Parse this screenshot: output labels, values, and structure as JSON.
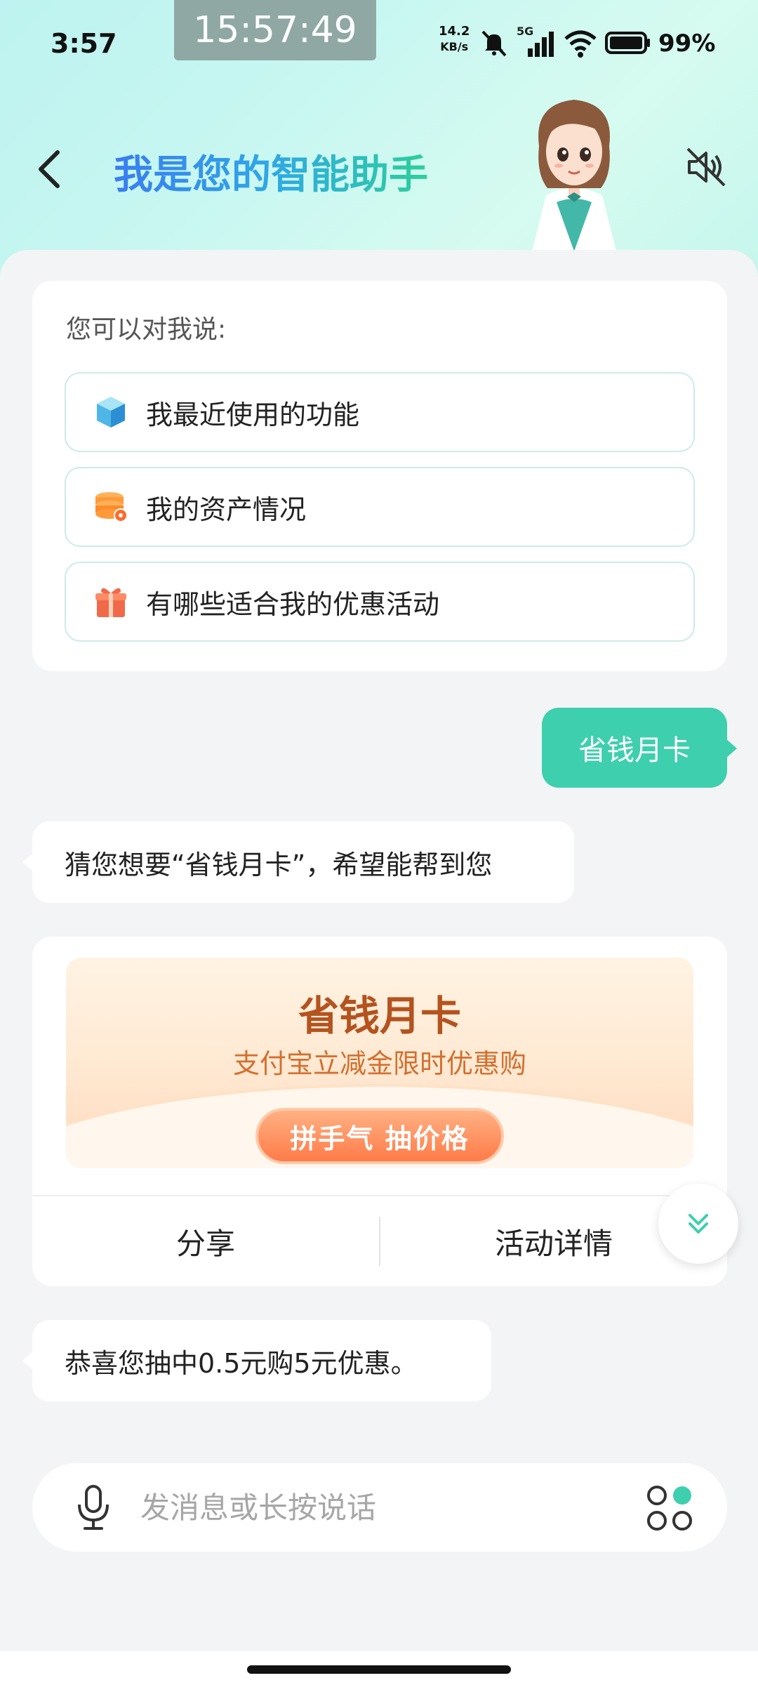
{
  "status_bar": {
    "time": "3:57",
    "clock_overlay": "15:57:49",
    "net_speed_value": "14.2",
    "net_speed_unit": "KB/s",
    "network": "5G",
    "battery": "99%"
  },
  "header": {
    "title": "我是您的智能助手"
  },
  "suggestions": {
    "title": "您可以对我说:",
    "items": [
      {
        "label": "我最近使用的功能",
        "icon": "cube-icon"
      },
      {
        "label": "我的资产情况",
        "icon": "coin-stack-icon"
      },
      {
        "label": "有哪些适合我的优惠活动",
        "icon": "gift-icon"
      }
    ]
  },
  "chat": {
    "user_message": "省钱月卡",
    "bot_message_1": "猜您想要“省钱月卡”，希望能帮到您",
    "promo": {
      "title": "省钱月卡",
      "subtitle": "支付宝立减金限时优惠购",
      "button": "拼手气 抽价格",
      "share": "分享",
      "details": "活动详情"
    },
    "bot_message_2": "恭喜您抽中0.5元购5元优惠。"
  },
  "input": {
    "placeholder": "发消息或长按说话"
  },
  "colors": {
    "accent": "#3ecfae",
    "promo_title": "#b4531e",
    "promo_button": "#ff7b48"
  }
}
